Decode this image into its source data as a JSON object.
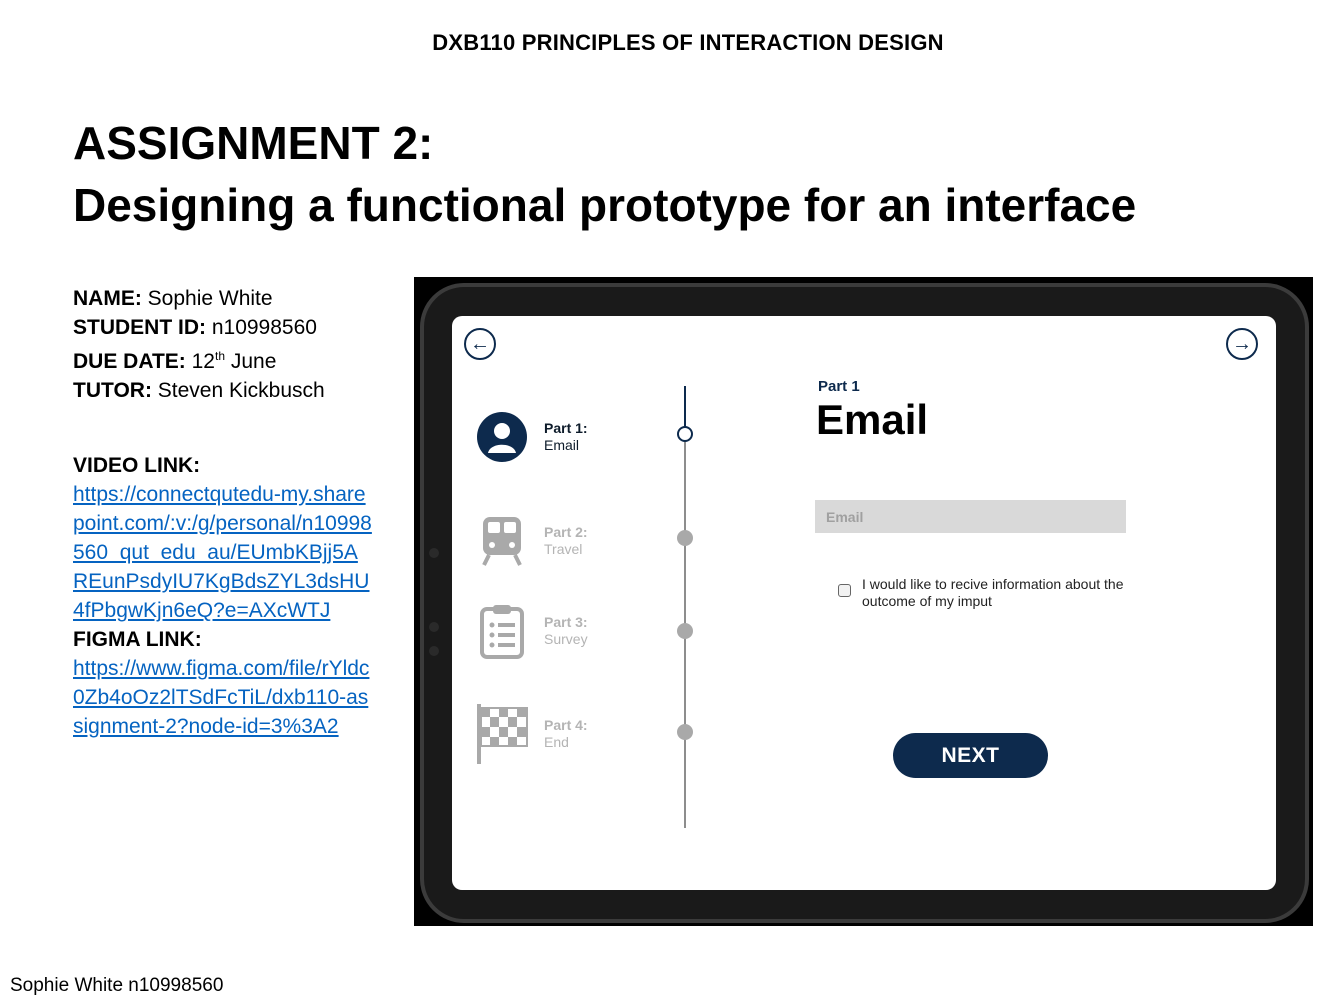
{
  "header": {
    "course": "DXB110 PRINCIPLES OF INTERACTION DESIGN",
    "title_line1": "ASSIGNMENT 2:",
    "title_line2": "Designing a functional prototype for an interface"
  },
  "info": {
    "name_label": "NAME:",
    "name_value": " Sophie White",
    "id_label": "STUDENT ID:",
    "id_value": " n10998560",
    "due_label": "DUE DATE:",
    "due_day": " 12",
    "due_sup": "th",
    "due_month": " June",
    "tutor_label": "TUTOR:",
    "tutor_value": " Steven Kickbusch",
    "video_label": "VIDEO LINK:",
    "video_url": "https://connectqutedu-my.sharepoint.com/:v:/g/personal/n10998560_qut_edu_au/EUmbKBjj5AREunPsdyIU7KgBdsZYL3dsHU4fPbgwKjn6eQ?e=AXcWTJ",
    "figma_label": "FIGMA LINK:",
    "figma_url": "https://www.figma.com/file/rYldc0Zb4oOz2lTSdFcTiL/dxb110-assignment-2?node-id=3%3A2"
  },
  "footer": {
    "author": "Sophie White n10998560"
  },
  "prototype": {
    "steps": [
      {
        "num": "Part 1:",
        "label": "Email",
        "state": "active",
        "icon": "user-icon"
      },
      {
        "num": "Part 2:",
        "label": "Travel",
        "state": "inactive",
        "icon": "train-icon"
      },
      {
        "num": "Part 3:",
        "label": "Survey",
        "state": "inactive",
        "icon": "clipboard-icon"
      },
      {
        "num": "Part 4:",
        "label": "End",
        "state": "inactive",
        "icon": "checkered-flag-icon"
      }
    ],
    "part_label": "Part 1",
    "heading": "Email",
    "email_placeholder": "Email",
    "checkbox_label": "I would like to recive information about the outcome of my imput",
    "next_label": "NEXT",
    "colors": {
      "primary": "#0d2a4d",
      "inactive": "#b4b4b4",
      "field_bg": "#d9d9d9"
    }
  }
}
